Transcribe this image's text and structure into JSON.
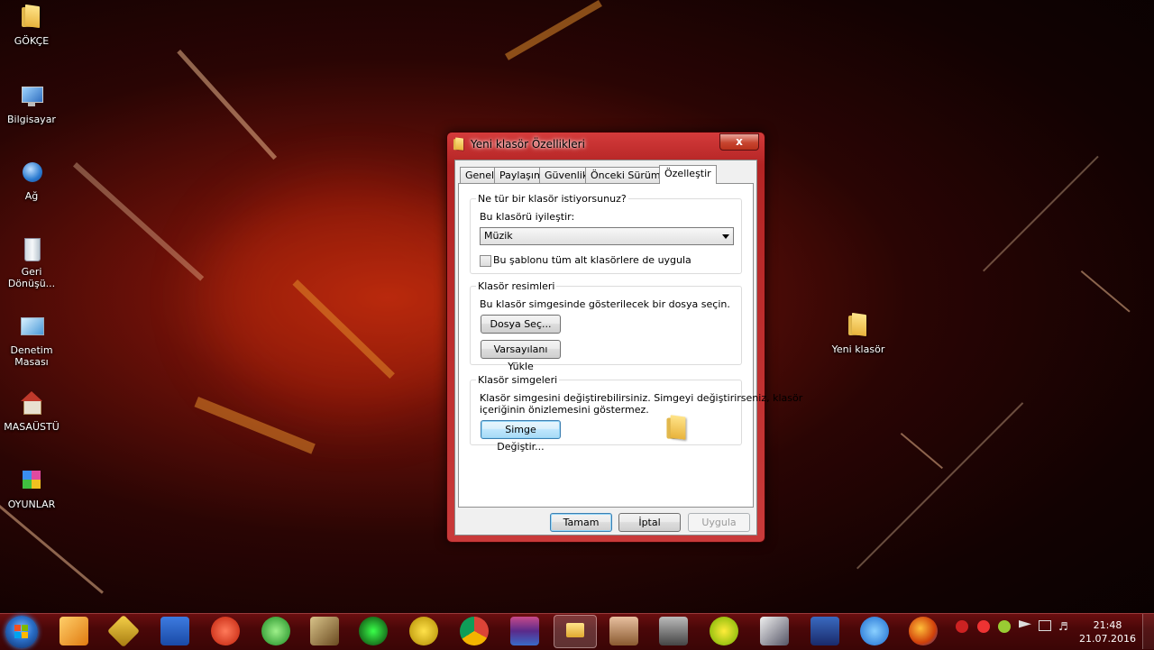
{
  "desktop": {
    "icons": [
      {
        "label": "GÖKÇE",
        "icon": "folder-user-icon"
      },
      {
        "label": "Bilgisayar",
        "icon": "computer-icon"
      },
      {
        "label": "Ağ",
        "icon": "network-icon"
      },
      {
        "label": "Geri Dönüşü...",
        "icon": "recycle-bin-icon"
      },
      {
        "label": "Denetim Masası",
        "icon": "control-panel-icon"
      },
      {
        "label": "MASAÜSTÜ",
        "icon": "home-network-icon"
      },
      {
        "label": "OYUNLAR",
        "icon": "games-icon"
      },
      {
        "label": "Yeni klasör",
        "icon": "folder-icon"
      }
    ]
  },
  "dialog": {
    "title": "Yeni klasör Özellikleri",
    "close_label": "x",
    "tabs": [
      "Genel",
      "Paylaşım",
      "Güvenlik",
      "Önceki Sürümler",
      "Özelleştir"
    ],
    "active_tab": "Özelleştir",
    "group1": {
      "legend": "Ne tür bir klasör istiyorsunuz?",
      "optimize_label": "Bu klasörü iyileştir:",
      "selected": "Müzik",
      "checkbox_label": "Bu şablonu tüm alt klasörlere de uygula",
      "checkbox_checked": false
    },
    "group2": {
      "legend": "Klasör resimleri",
      "desc": "Bu klasör simgesinde gösterilecek bir dosya seçin.",
      "choose_file": "Dosya Seç...",
      "restore_default": "Varsayılanı Yükle"
    },
    "group3": {
      "legend": "Klasör simgeleri",
      "desc_line1": "Klasör simgesini değiştirebilirsiniz. Simgeyi değiştirirseniz, klasör",
      "desc_line2": "içeriğinin önizlemesini göstermez.",
      "change_icon": "Simge Değiştir..."
    },
    "ok": "Tamam",
    "cancel": "İptal",
    "apply": "Uygula"
  },
  "taskbar": {
    "apps": [
      "media-player-icon",
      "winamp-icon",
      "word-icon",
      "no-entry-icon",
      "green-app-icon",
      "w-game-icon",
      "razer-icon",
      "triangle-app-icon",
      "chrome-icon",
      "winrar-icon",
      "explorer-icon",
      "avatar-game-icon",
      "truck-game-icon",
      "plus-app-icon",
      "graphics-icon",
      "powershell-icon",
      "ie-icon",
      "firefox-icon"
    ],
    "time": "21:48",
    "date": "21.07.2016"
  }
}
